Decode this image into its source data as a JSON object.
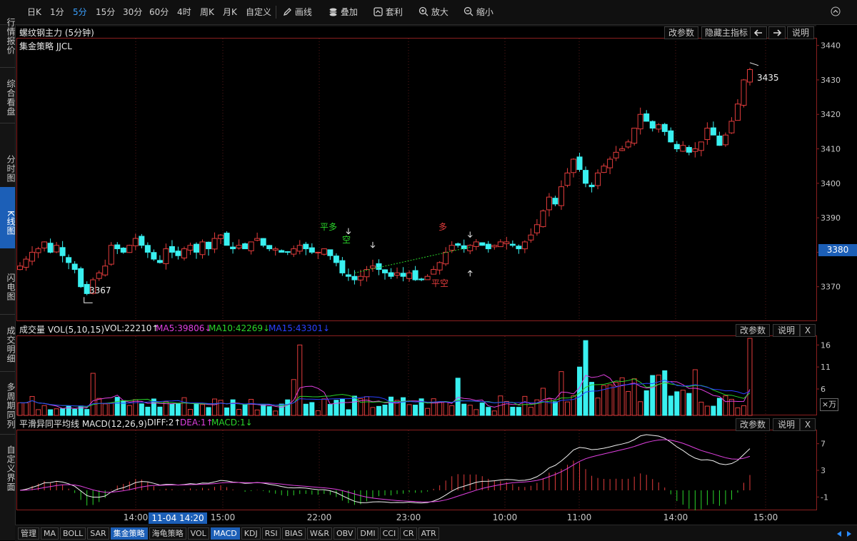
{
  "toolbar": {
    "items": [
      {
        "label": "日K",
        "active": false
      },
      {
        "label": "1分",
        "active": false
      },
      {
        "label": "5分",
        "active": true
      },
      {
        "label": "15分",
        "active": false
      },
      {
        "label": "30分",
        "active": false
      },
      {
        "label": "60分",
        "active": false
      },
      {
        "label": "4时",
        "active": false
      },
      {
        "label": "周K",
        "active": false
      },
      {
        "label": "月K",
        "active": false
      },
      {
        "label": "自定义",
        "active": false
      }
    ],
    "tools": [
      {
        "label": "画线",
        "icon": "pencil-icon"
      },
      {
        "label": "叠加",
        "icon": "layers-icon"
      },
      {
        "label": "套利",
        "icon": "arbitrage-icon"
      },
      {
        "label": "放大",
        "icon": "zoom-in-icon"
      },
      {
        "label": "缩小",
        "icon": "zoom-out-icon"
      }
    ]
  },
  "sidebar": {
    "items": [
      {
        "label": "行情报价",
        "active": false
      },
      {
        "label": "综合看盘",
        "active": false
      },
      {
        "label": "分时图",
        "active": false
      },
      {
        "label": "K线图",
        "active": true
      },
      {
        "label": "闪电图",
        "active": false
      },
      {
        "label": "成交明细",
        "active": false
      },
      {
        "label": "多周期同列",
        "active": false
      },
      {
        "label": "自定义界面",
        "active": false
      }
    ]
  },
  "main": {
    "title": "螺纹钢主力 (5分钟)",
    "strategy": "集金策略 JJCL",
    "buttons": {
      "params": "改参数",
      "hide": "隐藏主指标",
      "explain": "说明"
    },
    "high_label": "3435",
    "low_label": "3367",
    "current_price": "3380",
    "signals": [
      "平多",
      "空",
      "多",
      "平空"
    ],
    "colors": {
      "up": "#e23c3c",
      "down": "#39f0f0",
      "signal_green": "#2ad52a",
      "signal_red": "#e23c3c"
    }
  },
  "volume": {
    "title": "成交量 VOL(5,10,15)",
    "vol": "VOL:22210↑",
    "ma5": "MA5:39806↓",
    "ma10": "MA10:42269↓",
    "ma15": "MA15:43301↓",
    "unit": "×万",
    "buttons": {
      "params": "改参数",
      "explain": "说明",
      "close": "X"
    }
  },
  "macd": {
    "title": "平滑异同平均线 MACD(12,26,9)",
    "diff": "DIFF:2↑",
    "dea": "DEA:1↑",
    "macd": "MACD:1↓",
    "buttons": {
      "params": "改参数",
      "explain": "说明",
      "close": "X"
    }
  },
  "xaxis": {
    "ticks": [
      "14:00",
      "15:00",
      "22:00",
      "23:00",
      "10:00",
      "11:00",
      "14:00",
      "15:00"
    ],
    "cursor": "11-04 14:20"
  },
  "bottom_tabs": [
    {
      "label": "管理",
      "active": false
    },
    {
      "label": "MA",
      "active": false
    },
    {
      "label": "BOLL",
      "active": false
    },
    {
      "label": "SAR",
      "active": false
    },
    {
      "label": "集金策略",
      "active": true
    },
    {
      "label": "海龟策略",
      "active": false
    },
    {
      "label": "VOL",
      "active": false
    },
    {
      "label": "MACD",
      "active": true
    },
    {
      "label": "KDJ",
      "active": false
    },
    {
      "label": "RSI",
      "active": false
    },
    {
      "label": "BIAS",
      "active": false
    },
    {
      "label": "W&R",
      "active": false
    },
    {
      "label": "OBV",
      "active": false
    },
    {
      "label": "DMI",
      "active": false
    },
    {
      "label": "CCI",
      "active": false
    },
    {
      "label": "CR",
      "active": false
    },
    {
      "label": "ATR",
      "active": false
    }
  ],
  "chart_data": [
    {
      "type": "candlestick",
      "title": "螺纹钢主力 (5分钟)",
      "y_ticks": [
        3370,
        3380,
        3390,
        3400,
        3410,
        3420,
        3430,
        3440
      ],
      "ylim": [
        3360,
        3442
      ],
      "close": [
        3376,
        3378,
        3380,
        3381,
        3383,
        3380,
        3382,
        3379,
        3377,
        3375,
        3370,
        3368,
        3372,
        3374,
        3376,
        3382,
        3381,
        3380,
        3382,
        3384,
        3382,
        3380,
        3378,
        3377,
        3381,
        3380,
        3379,
        3381,
        3382,
        3380,
        3383,
        3381,
        3384,
        3385,
        3382,
        3381,
        3382,
        3381,
        3383,
        3384,
        3382,
        3381,
        3381,
        3380,
        3380,
        3381,
        3382,
        3381,
        3380,
        3380,
        3381,
        3379,
        3377,
        3374,
        3373,
        3372,
        3373,
        3375,
        3376,
        3375,
        3374,
        3373,
        3374,
        3373,
        3374,
        3372,
        3372,
        3373,
        3375,
        3377,
        3380,
        3382,
        3382,
        3381,
        3382,
        3383,
        3382,
        3381,
        3382,
        3383,
        3383,
        3382,
        3381,
        3383,
        3385,
        3388,
        3392,
        3396,
        3394,
        3399,
        3403,
        3407,
        3404,
        3400,
        3399,
        3403,
        3405,
        3407,
        3409,
        3410,
        3412,
        3416,
        3420,
        3418,
        3416,
        3417,
        3415,
        3412,
        3410,
        3411,
        3409,
        3410,
        3412,
        3416,
        3414,
        3411,
        3414,
        3418,
        3423,
        3430,
        3433
      ],
      "high_label": 3435,
      "low_label": 3367,
      "current": 3380
    },
    {
      "type": "bar",
      "title": "成交量 VOL(5,10,15)",
      "unit": "×万",
      "y_ticks": [
        6,
        11,
        16
      ],
      "series": [
        {
          "name": "MA5",
          "value": 39806
        },
        {
          "name": "MA10",
          "value": 42269
        },
        {
          "name": "MA15",
          "value": 43301
        }
      ],
      "vol": 22210
    },
    {
      "type": "line",
      "title": "平滑异同平均线 MACD(12,26,9)",
      "y_ticks": [
        7,
        3,
        -1
      ],
      "series": [
        {
          "name": "DIFF",
          "value": 2
        },
        {
          "name": "DEA",
          "value": 1
        },
        {
          "name": "MACD",
          "value": 1
        }
      ]
    }
  ]
}
